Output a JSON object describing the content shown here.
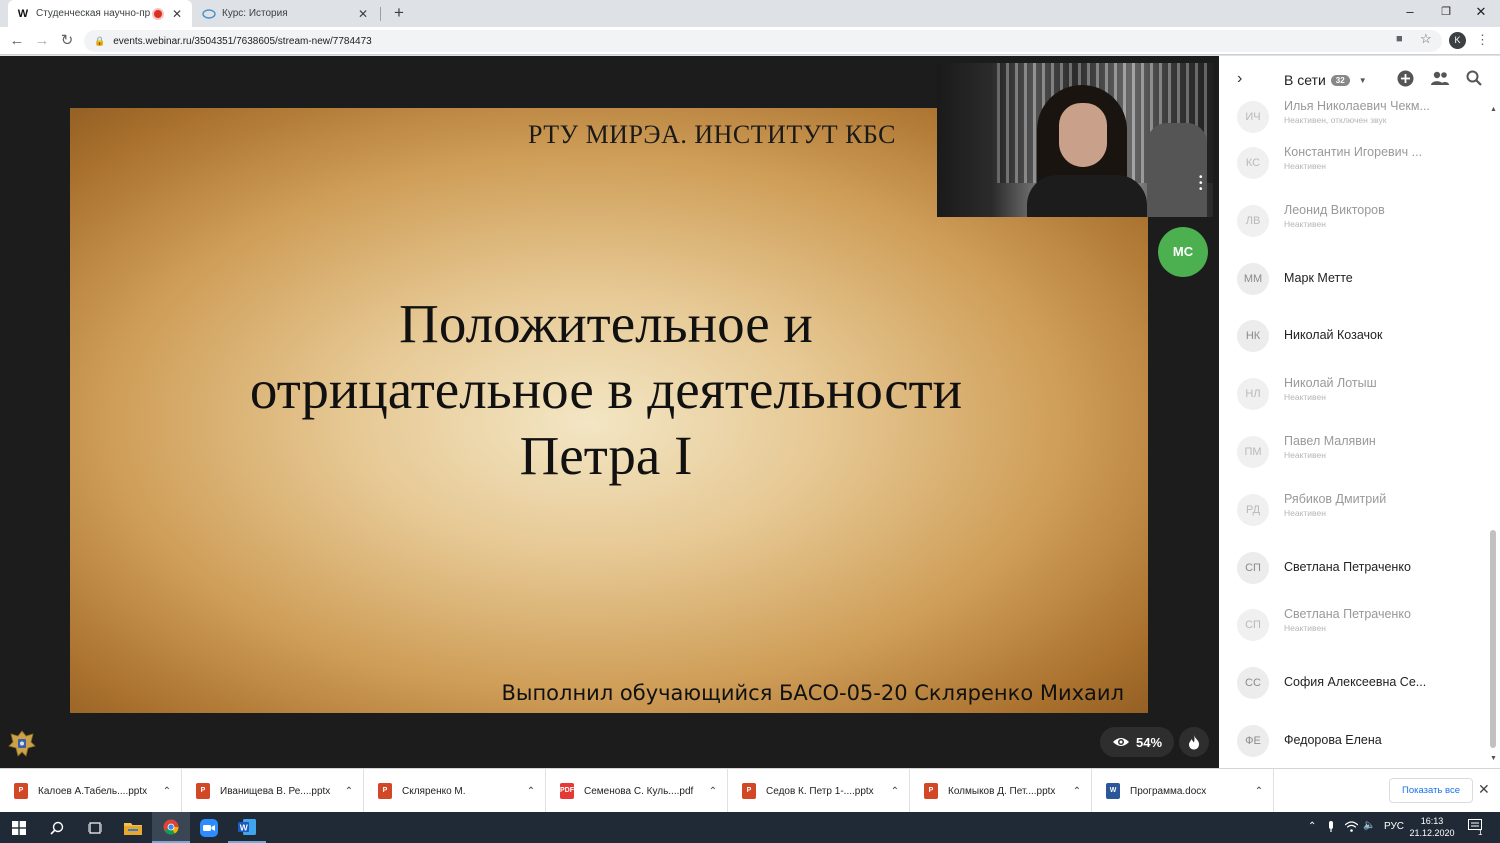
{
  "browser": {
    "tabs": [
      {
        "favicon": "W",
        "title": "Студенческая научно-практ",
        "recording": true
      },
      {
        "favicon": "webinar",
        "title": "Курс: История",
        "recording": false
      }
    ],
    "url": "events.webinar.ru/3504351/7638605/stream-new/7784473",
    "profile_initial": "K"
  },
  "slide": {
    "header": "РТУ МИРЭА. ИНСТИТУТ КБС",
    "title_lines": [
      "Положительное и",
      "отрицательное в деятельности",
      "Петра I"
    ],
    "author": "Выполнил обучающийся БАСО-05-20 Скляренко Михаил"
  },
  "stage": {
    "speaker_initials": "МС",
    "viewers_percent": "54%"
  },
  "panel": {
    "title": "В сети",
    "count": "32",
    "participants": [
      {
        "initials": "ИЧ",
        "name": "Илья Николаевич Чекм...",
        "status": "Неактивен, отключен звук"
      },
      {
        "initials": "КС",
        "name": "Константин Игоревич ...",
        "status": "Неактивен"
      },
      {
        "initials": "ЛВ",
        "name": "Леонид Викторов",
        "status": "Неактивен"
      },
      {
        "initials": "ММ",
        "name": "Марк Метте",
        "status": ""
      },
      {
        "initials": "НК",
        "name": "Николай Козачок",
        "status": ""
      },
      {
        "initials": "НЛ",
        "name": "Николай Лотыш",
        "status": "Неактивен"
      },
      {
        "initials": "ПМ",
        "name": "Павел Малявин",
        "status": "Неактивен"
      },
      {
        "initials": "РД",
        "name": "Рябиков Дмитрий",
        "status": "Неактивен"
      },
      {
        "initials": "СП",
        "name": "Светлана Петраченко",
        "status": ""
      },
      {
        "initials": "СП",
        "name": "Светлана Петраченко",
        "status": "Неактивен"
      },
      {
        "initials": "СС",
        "name": "София Алексеевна Се...",
        "status": ""
      },
      {
        "initials": "ФЕ",
        "name": "Федорова Елена",
        "status": ""
      }
    ]
  },
  "downloads": {
    "items": [
      {
        "type": "ppt",
        "name": "Калоев А.Табель....pptx"
      },
      {
        "type": "ppt",
        "name": "Иванищева В. Ре....pptx"
      },
      {
        "type": "ppt",
        "name": "Скляренко М."
      },
      {
        "type": "pdf",
        "name": "Семенова С. Куль....pdf"
      },
      {
        "type": "ppt",
        "name": "Седов К. Петр 1-....pptx"
      },
      {
        "type": "ppt",
        "name": "Колмыков Д. Пет....pptx"
      },
      {
        "type": "doc",
        "name": "Программа.docx"
      }
    ],
    "show_all": "Показать все"
  },
  "taskbar": {
    "language": "РУС",
    "time": "16:13",
    "date": "21.12.2020",
    "notifications": "1"
  },
  "colors": {
    "speaker_avatar": "#4caf50",
    "link_blue": "#1a73e8",
    "taskbar": "#1f2a36"
  }
}
